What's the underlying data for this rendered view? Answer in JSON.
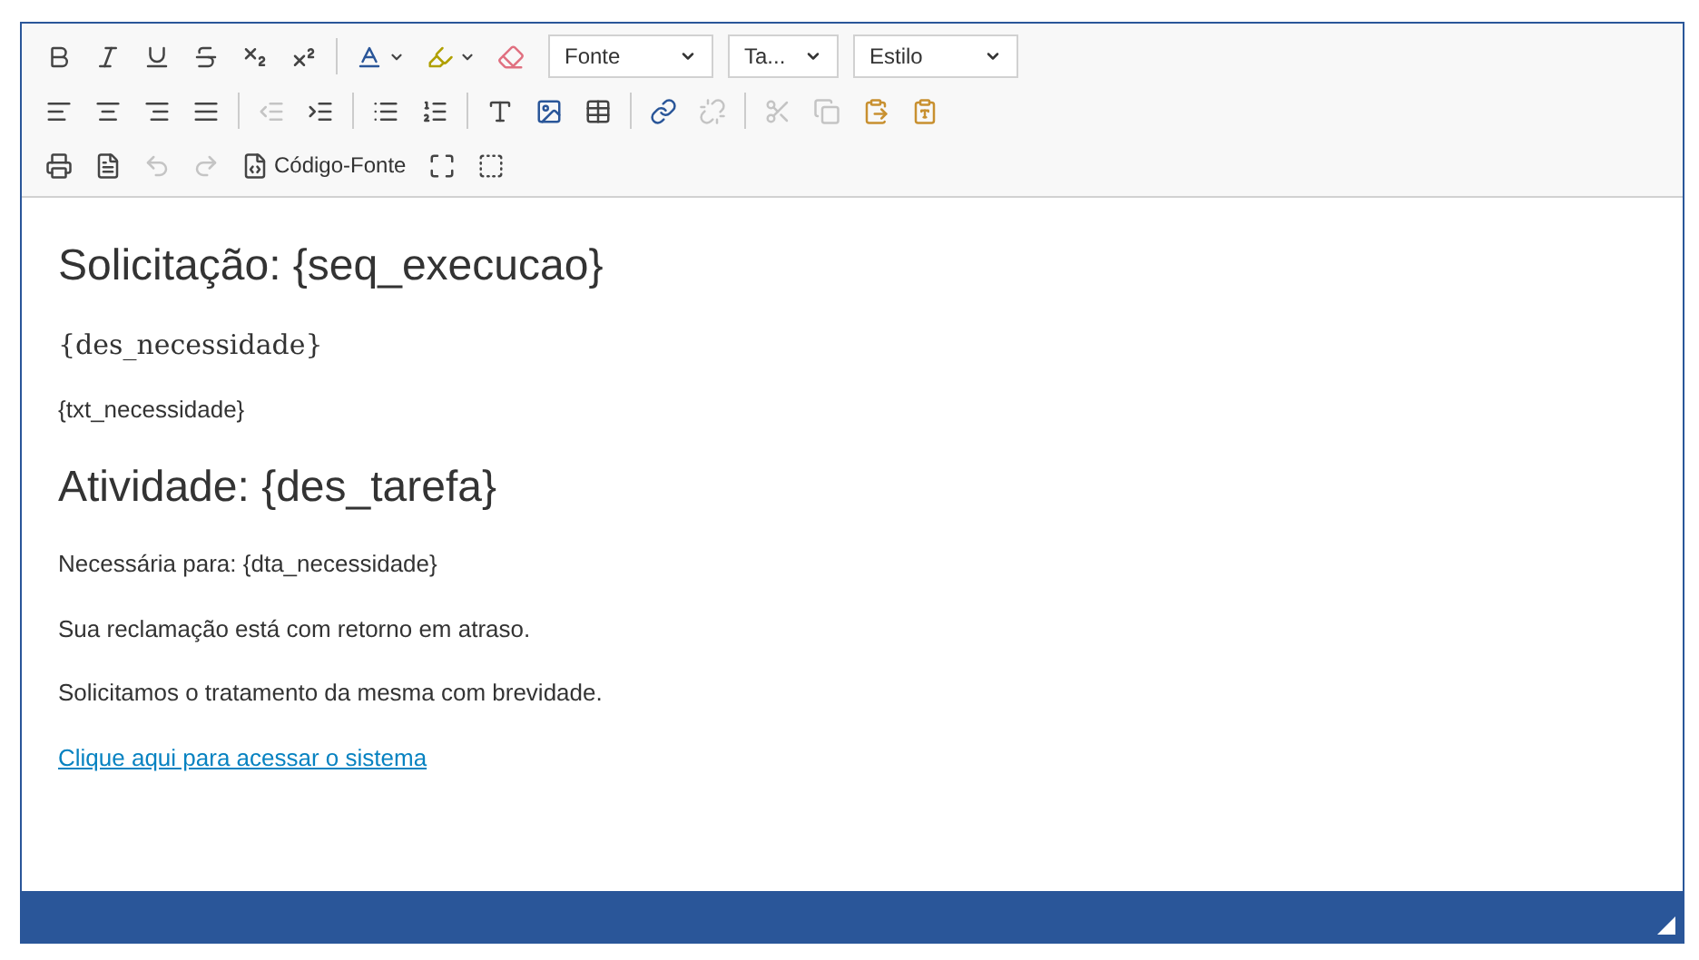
{
  "toolbar": {
    "rows": [
      [
        {
          "kind": "button",
          "disabled": false
        },
        {
          "kind": "button",
          "disabled": false
        },
        {
          "kind": "button",
          "disabled": false
        },
        {
          "kind": "button",
          "disabled": false
        },
        {
          "kind": "button",
          "disabled": false
        },
        {
          "kind": "button",
          "disabled": false
        },
        {
          "kind": "separator"
        },
        {
          "kind": "menu-button",
          "disabled": false
        },
        {
          "kind": "menu-button",
          "disabled": false
        },
        {
          "kind": "button",
          "disabled": false
        },
        {
          "kind": "dropdown",
          "label": "Fonte"
        },
        {
          "kind": "dropdown",
          "label": "Ta..."
        },
        {
          "kind": "dropdown",
          "label": "Estilo"
        }
      ],
      [
        {
          "kind": "button",
          "disabled": false
        },
        {
          "kind": "button",
          "disabled": false
        },
        {
          "kind": "button",
          "disabled": false
        },
        {
          "kind": "button",
          "disabled": false
        },
        {
          "kind": "separator"
        },
        {
          "kind": "button",
          "disabled": true
        },
        {
          "kind": "button",
          "disabled": false
        },
        {
          "kind": "separator"
        },
        {
          "kind": "button",
          "disabled": false
        },
        {
          "kind": "button",
          "disabled": false
        },
        {
          "kind": "separator"
        },
        {
          "kind": "button",
          "disabled": false
        },
        {
          "kind": "button",
          "disabled": false
        },
        {
          "kind": "button",
          "disabled": false
        },
        {
          "kind": "separator"
        },
        {
          "kind": "button",
          "disabled": false
        },
        {
          "kind": "button",
          "disabled": true
        },
        {
          "kind": "separator"
        },
        {
          "kind": "button",
          "disabled": true
        },
        {
          "kind": "button",
          "disabled": true
        },
        {
          "kind": "button",
          "disabled": false
        },
        {
          "kind": "button",
          "disabled": false
        }
      ],
      [
        {
          "kind": "button",
          "disabled": false
        },
        {
          "kind": "button",
          "disabled": false
        },
        {
          "kind": "button",
          "disabled": true
        },
        {
          "kind": "button",
          "disabled": true
        },
        {
          "kind": "text-button",
          "label": "Código-Fonte",
          "disabled": false
        },
        {
          "kind": "button",
          "disabled": false
        },
        {
          "kind": "button",
          "disabled": false
        }
      ]
    ]
  },
  "content": [
    {
      "kind": "heading1",
      "text": "Solicitação: {seq_execucao}"
    },
    {
      "kind": "heading3",
      "text": "{des_necessidade}"
    },
    {
      "kind": "paragraph",
      "text": "{txt_necessidade}"
    },
    {
      "kind": "heading1",
      "text": "Atividade: {des_tarefa}"
    },
    {
      "kind": "paragraph",
      "text": "Necessária para: {dta_necessidade}"
    },
    {
      "kind": "paragraph",
      "text": "Sua reclamação está com retorno em atraso."
    },
    {
      "kind": "paragraph",
      "text": "Solicitamos o tratamento da mesma com brevidade."
    },
    {
      "kind": "link",
      "text": "Clique aqui para acessar o sistema"
    }
  ]
}
